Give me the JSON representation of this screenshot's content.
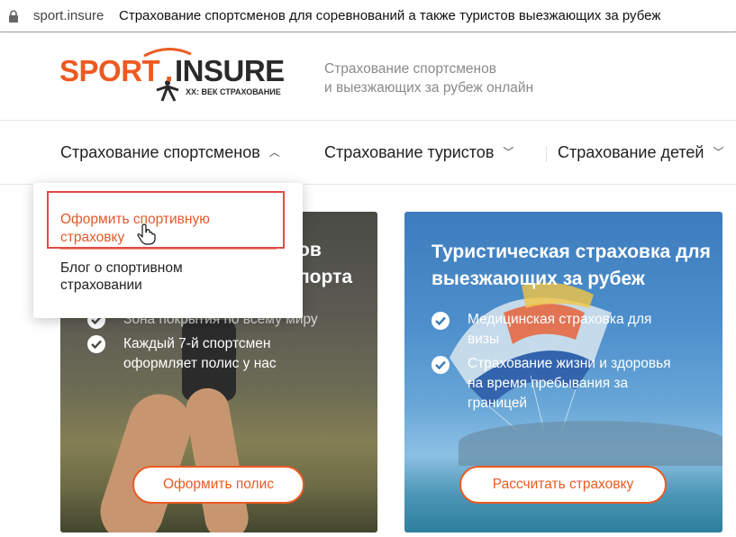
{
  "browser": {
    "domain": "sport.insure",
    "page_title": "Страхование спортсменов для соревнований а также туристов выезжающих за рубеж"
  },
  "header": {
    "logo": {
      "word1": "SPORT",
      "dot": ".",
      "word2": "INSURE",
      "tagline": "XX: ВЕК СТРАХОВАНИЕ"
    },
    "tagline_line1": "Страхование спортсменов",
    "tagline_line2": "и выезжающих за рубеж онлайн"
  },
  "nav": {
    "items": [
      {
        "label": "Страхование спортсменов",
        "chevron": "chevron-up-icon"
      },
      {
        "label": "Страхование туристов",
        "chevron": "chevron-down-icon"
      },
      {
        "label": "Страхование детей",
        "chevron": "chevron-down-icon"
      }
    ]
  },
  "dropdown": {
    "items": [
      {
        "line1": "Оформить спортивную",
        "line2": "страховку",
        "active": true
      },
      {
        "line1": "Блог о спортивном",
        "line2": "страховании",
        "active": false
      }
    ]
  },
  "cards": [
    {
      "title_line1_suffix": "ов",
      "title_line2_suffix": "порта",
      "bullets": [
        {
          "line1": "Зона покрытия по всему миру"
        },
        {
          "line1": "Каждый 7-й спортсмен",
          "line2": "оформляет полис у нас"
        }
      ],
      "button": "Оформить полис"
    },
    {
      "title_line1": "Туристическая страховка для",
      "title_line2": "выезжающих за рубеж",
      "bullets": [
        {
          "line1": "Медицинская страховка для",
          "line2": "визы"
        },
        {
          "line1": "Страхование жизни и здоровья",
          "line2": "на время пребывания за",
          "line3": "границей"
        }
      ],
      "button": "Рассчитать страховку"
    }
  ],
  "colors": {
    "accent": "#ec5a21",
    "highlight": "#e04a4a"
  }
}
